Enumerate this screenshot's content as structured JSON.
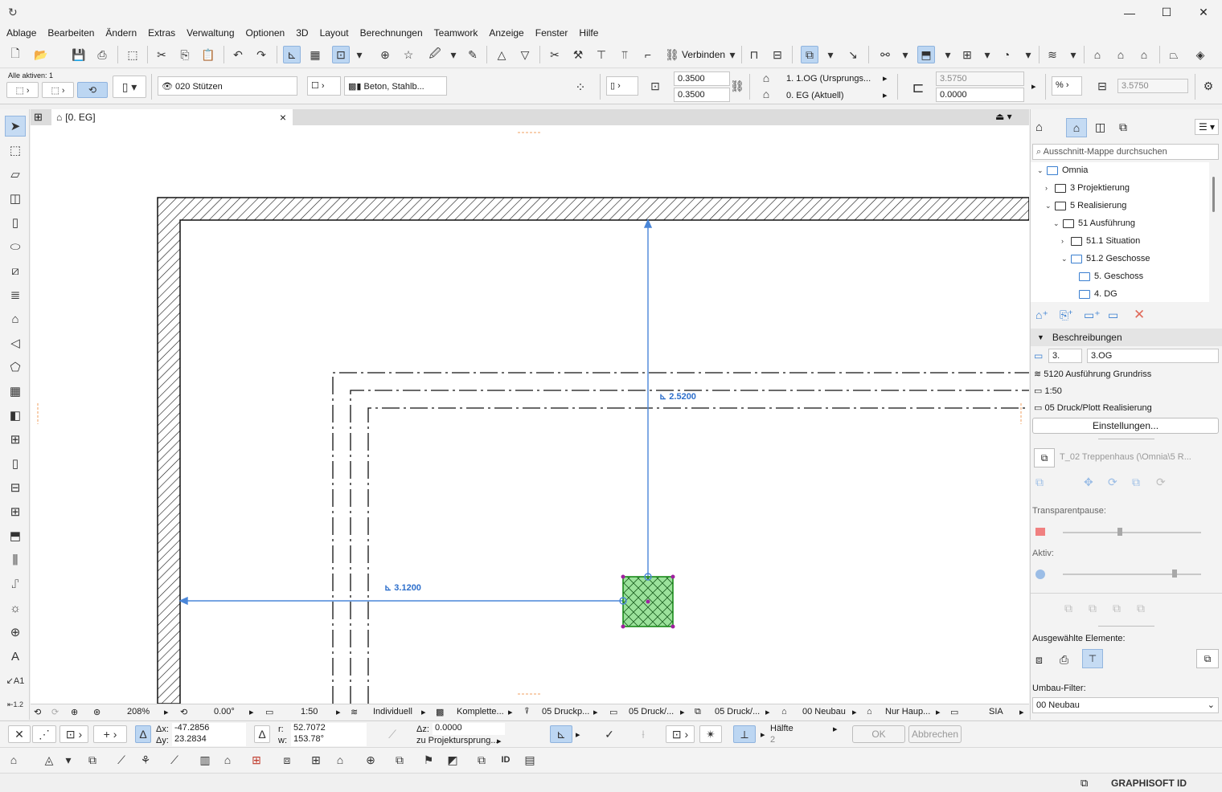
{
  "menu": [
    "Ablage",
    "Bearbeiten",
    "Ändern",
    "Extras",
    "Verwaltung",
    "Optionen",
    "3D",
    "Layout",
    "Berechnungen",
    "Teamwork",
    "Anzeige",
    "Fenster",
    "Hilfe"
  ],
  "toolbar": {
    "connect_label": "Verbinden"
  },
  "infobox": {
    "alle_aktiven": "Alle aktiven: 1",
    "layer": "020 Stützen",
    "material": "Beton, Stahlb...",
    "width": "0.3500",
    "depth": "0.3500",
    "top_story": "1. 1.OG (Ursprungs...",
    "home_story": "0. EG (Aktuell)",
    "height": "3.5750",
    "offset": "0.0000",
    "height2": "3.5750"
  },
  "tab": {
    "label": "[0. EG]",
    "close": "×"
  },
  "canvas": {
    "dim_vertical": "2.5200",
    "dim_horizontal": "3.1200"
  },
  "navigator": {
    "search_placeholder": "Ausschnitt-Mappe durchsuchen",
    "tree": [
      {
        "label": "Omnia",
        "level": 0,
        "arrow": "⌄",
        "blue": true
      },
      {
        "label": "3 Projektierung",
        "level": 1,
        "arrow": "›",
        "blue": false
      },
      {
        "label": "5 Realisierung",
        "level": 1,
        "arrow": "⌄",
        "blue": false
      },
      {
        "label": "51 Ausführung",
        "level": 2,
        "arrow": "⌄",
        "blue": false
      },
      {
        "label": "51.1 Situation",
        "level": 3,
        "arrow": "›",
        "blue": false
      },
      {
        "label": "51.2 Geschosse",
        "level": 3,
        "arrow": "⌄",
        "blue": true
      },
      {
        "label": "5. Geschoss",
        "level": 4,
        "arrow": "",
        "blue": true
      },
      {
        "label": "4. DG",
        "level": 4,
        "arrow": "",
        "blue": true
      }
    ],
    "beschreibungen_header": "Beschreibungen",
    "id_value": "3.",
    "name_value": "3.OG",
    "layer_combo": "5120 Ausführung Grundriss",
    "scale": "1:50",
    "pen_set": "05 Druck/Plott Realisierung",
    "einstellungen": "Einstellungen...",
    "source_view": "T_02 Treppenhaus (\\Omnia\\5 R...",
    "transparentpause_label": "Transparentpause:",
    "aktiv_label": "Aktiv:",
    "ausgewaehlte_label": "Ausgewählte Elemente:",
    "umbau_label": "Umbau-Filter:",
    "umbau_value": "00 Neubau"
  },
  "status": {
    "zoom": "208%",
    "angle": "0.00°",
    "scale": "1:50",
    "layer_combo": "Individuell",
    "model_view": "Komplette...",
    "pen_set": "05 Druckp...",
    "dim_std": "05 Druck/...",
    "renov": "05 Druck/...",
    "renov2": "00 Neubau",
    "struct": "Nur Haup...",
    "dim": "SIA"
  },
  "coords": {
    "dx_label": "Δx:",
    "dx": "-47.2856",
    "dy_label": "Δy:",
    "dy": "23.2834",
    "r_label": "r:",
    "r": "52.7072",
    "w_label": "w:",
    "w": "153.78°",
    "dz_label": "Δz:",
    "dz": "0.0000",
    "ref": "zu Projektursprung...",
    "haelfte": "Hälfte",
    "haelfte_n": "2",
    "ok": "OK",
    "abbrechen": "Abbrechen"
  },
  "footer": {
    "brand": "GRAPHISOFT ID"
  }
}
